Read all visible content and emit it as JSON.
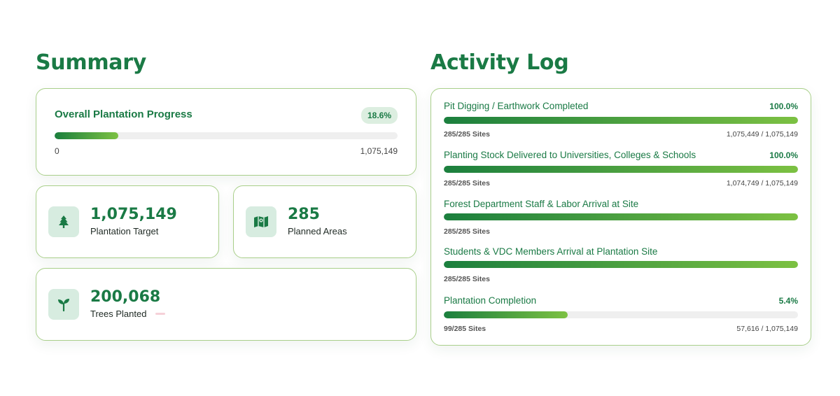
{
  "summary": {
    "title": "Summary",
    "overall": {
      "heading": "Overall Plantation Progress",
      "badge": "18.6%",
      "progress": 0.186,
      "min_label": "0",
      "max_label": "1,075,149"
    },
    "stats": [
      {
        "value": "1,075,149",
        "label": "Plantation Target",
        "icon": "tree-icon"
      },
      {
        "value": "285",
        "label": "Planned Areas",
        "icon": "map-icon"
      },
      {
        "value": "200,068",
        "label": "Trees Planted",
        "icon": "sprout-icon"
      }
    ]
  },
  "activity": {
    "title": "Activity Log",
    "items": [
      {
        "name": "Pit Digging / Earthwork Completed",
        "percent": "100.0%",
        "progress": 1.0,
        "sites": "285/285 Sites",
        "count": "1,075,449 / 1,075,149"
      },
      {
        "name": "Planting Stock Delivered to Universities, Colleges & Schools",
        "percent": "100.0%",
        "progress": 1.0,
        "sites": "285/285 Sites",
        "count": "1,074,749 / 1,075,149"
      },
      {
        "name": "Forest Department Staff & Labor Arrival at Site",
        "percent": "",
        "progress": 1.0,
        "sites": "285/285 Sites",
        "count": ""
      },
      {
        "name": "Students & VDC Members Arrival at Plantation Site",
        "percent": "",
        "progress": 1.0,
        "sites": "285/285 Sites",
        "count": ""
      },
      {
        "name": "Plantation Completion",
        "percent": "5.4%",
        "progress": 0.35,
        "sites": "99/285 Sites",
        "count": "57,616 / 1,075,149"
      }
    ]
  },
  "colors": {
    "brand": "#1a7a45",
    "gradient_start": "#1b7f3e",
    "gradient_end": "#7cc142",
    "card_border": "#a9cf8a"
  }
}
